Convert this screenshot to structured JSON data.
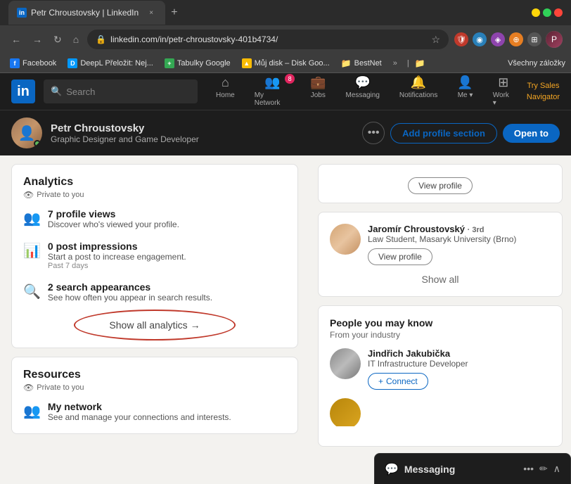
{
  "browser": {
    "title": "Petr Chroustovsky | LinkedIn",
    "url": "linkedin.com/in/petr-chroustovsky-401b4734/",
    "tab_close": "×",
    "tab_add": "+"
  },
  "nav": {
    "back": "←",
    "forward": "→",
    "refresh": "↻",
    "home": "⌂"
  },
  "bookmarks": [
    {
      "id": "facebook",
      "label": "Facebook",
      "type": "fb"
    },
    {
      "id": "deepl",
      "label": "DeepL Přeložit: Nej...",
      "type": "deepl"
    },
    {
      "id": "sheets",
      "label": "Tabulky Google",
      "type": "sheets"
    },
    {
      "id": "drive",
      "label": "Můj disk – Disk Goo...",
      "type": "drive"
    },
    {
      "id": "bestnet",
      "label": "BestNet",
      "type": "folder"
    }
  ],
  "bookmarks_more": "»",
  "bookmarks_all": "Všechny záložky",
  "linkedin": {
    "logo": "in",
    "search_placeholder": "Search",
    "nav_items": [
      {
        "id": "home",
        "icon": "⌂",
        "label": "Home",
        "active": false
      },
      {
        "id": "network",
        "icon": "👥",
        "label": "My Network",
        "active": false,
        "badge": "8"
      },
      {
        "id": "jobs",
        "icon": "💼",
        "label": "Jobs",
        "active": false
      },
      {
        "id": "messaging",
        "icon": "💬",
        "label": "Messaging",
        "active": false
      },
      {
        "id": "notifications",
        "icon": "🔔",
        "label": "Notifications",
        "active": false
      },
      {
        "id": "me",
        "icon": "👤",
        "label": "Me",
        "active": false
      },
      {
        "id": "grid",
        "icon": "⊞",
        "label": "Work",
        "active": false
      }
    ],
    "try_sales": "Try Sales\nNavigator",
    "profile": {
      "name": "Petr Chroustovsky",
      "title": "Graphic Designer and Game Developer",
      "btn_more": "•••",
      "btn_add_section": "Add profile section",
      "btn_open_to": "Open to"
    },
    "analytics": {
      "title": "Analytics",
      "private_label": "Private to you",
      "items": [
        {
          "icon": "👥",
          "bold": "7 profile views",
          "desc": "Discover who's viewed your profile."
        },
        {
          "icon": "📊",
          "bold": "0 post impressions",
          "desc": "Start a post to increase engagement.",
          "sub": "Past 7 days"
        },
        {
          "icon": "🔍",
          "bold": "2 search appearances",
          "desc": "See how often you appear in search results."
        }
      ],
      "show_all": "Show all analytics →"
    },
    "resources": {
      "title": "Resources",
      "private_label": "Private to you",
      "items": [
        {
          "icon": "👥",
          "bold": "My network",
          "desc": "See and manage your connections and interests."
        }
      ]
    },
    "sidebar": {
      "view_profile_top": "View profile",
      "people_you_may_know": "People you may know",
      "people_from_industry": "From your industry",
      "people": [
        {
          "name": "Jaromír Chroustovský",
          "connection": "3rd",
          "title": "Law Student, Masaryk University (Brno)",
          "btn": "View profile"
        },
        {
          "name": "Jindřich Jakubička",
          "connection": "",
          "title": "IT Infrastructure Developer",
          "btn": "Connect"
        }
      ],
      "show_all": "Show all"
    }
  },
  "messaging_bar": {
    "label": "Messaging",
    "icons": [
      "•••",
      "✏",
      "∧"
    ]
  }
}
